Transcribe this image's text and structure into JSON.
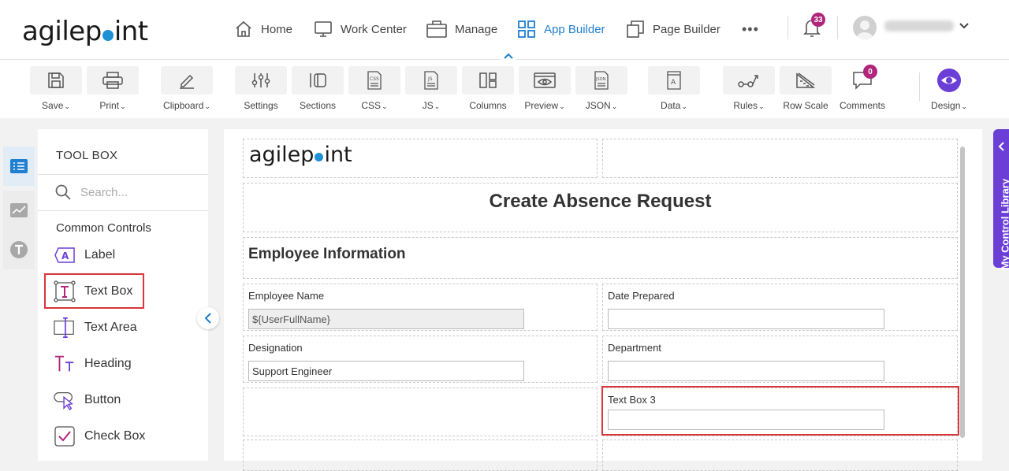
{
  "brand": {
    "logo_left": "agilep",
    "logo_right": "int"
  },
  "topnav": {
    "items": [
      {
        "label": "Home",
        "icon": "home-icon"
      },
      {
        "label": "Work Center",
        "icon": "monitor-icon"
      },
      {
        "label": "Manage",
        "icon": "briefcase-icon"
      },
      {
        "label": "App Builder",
        "icon": "grid-icon",
        "active": true
      },
      {
        "label": "Page Builder",
        "icon": "pages-icon"
      }
    ],
    "more": "•••",
    "notifications_count": "33"
  },
  "ribbon": {
    "buttons": [
      {
        "label": "Save",
        "dropdown": true
      },
      {
        "label": "Print",
        "dropdown": true
      },
      {
        "label": "Clipboard",
        "dropdown": true
      },
      {
        "label": "Settings",
        "dropdown": false
      },
      {
        "label": "Sections",
        "dropdown": false
      },
      {
        "label": "CSS",
        "dropdown": true
      },
      {
        "label": "JS",
        "dropdown": true
      },
      {
        "label": "Columns",
        "dropdown": false
      },
      {
        "label": "Preview",
        "dropdown": true
      },
      {
        "label": "JSON",
        "dropdown": true
      },
      {
        "label": "Data",
        "dropdown": true
      },
      {
        "label": "Rules",
        "dropdown": true
      },
      {
        "label": "Row Scale",
        "dropdown": false
      },
      {
        "label": "Comments",
        "dropdown": false
      },
      {
        "label": "Design",
        "dropdown": true
      }
    ],
    "comments_count": "0",
    "caret": "⌄"
  },
  "toolbox": {
    "title": "TOOL BOX",
    "search_placeholder": "Search...",
    "group": "Common Controls",
    "items": [
      "Label",
      "Text Box",
      "Text Area",
      "Heading",
      "Button",
      "Check Box"
    ]
  },
  "form": {
    "logo_left": "agilep",
    "logo_right": "int",
    "title": "Create Absence Request",
    "section": "Employee Information",
    "fields": {
      "employee_name": {
        "label": "Employee Name",
        "value": "${UserFullName}"
      },
      "date_prepared": {
        "label": "Date Prepared",
        "value": ""
      },
      "designation": {
        "label": "Designation",
        "value": "Support Engineer"
      },
      "department": {
        "label": "Department",
        "value": ""
      },
      "text_box_3": {
        "label": "Text Box 3",
        "value": ""
      }
    }
  },
  "control_library": {
    "label": "My Control Library"
  },
  "colors": {
    "accent": "#1f7fd0",
    "badge": "#b0267a",
    "purple": "#6b3fd6",
    "highlight": "#d9363e"
  }
}
